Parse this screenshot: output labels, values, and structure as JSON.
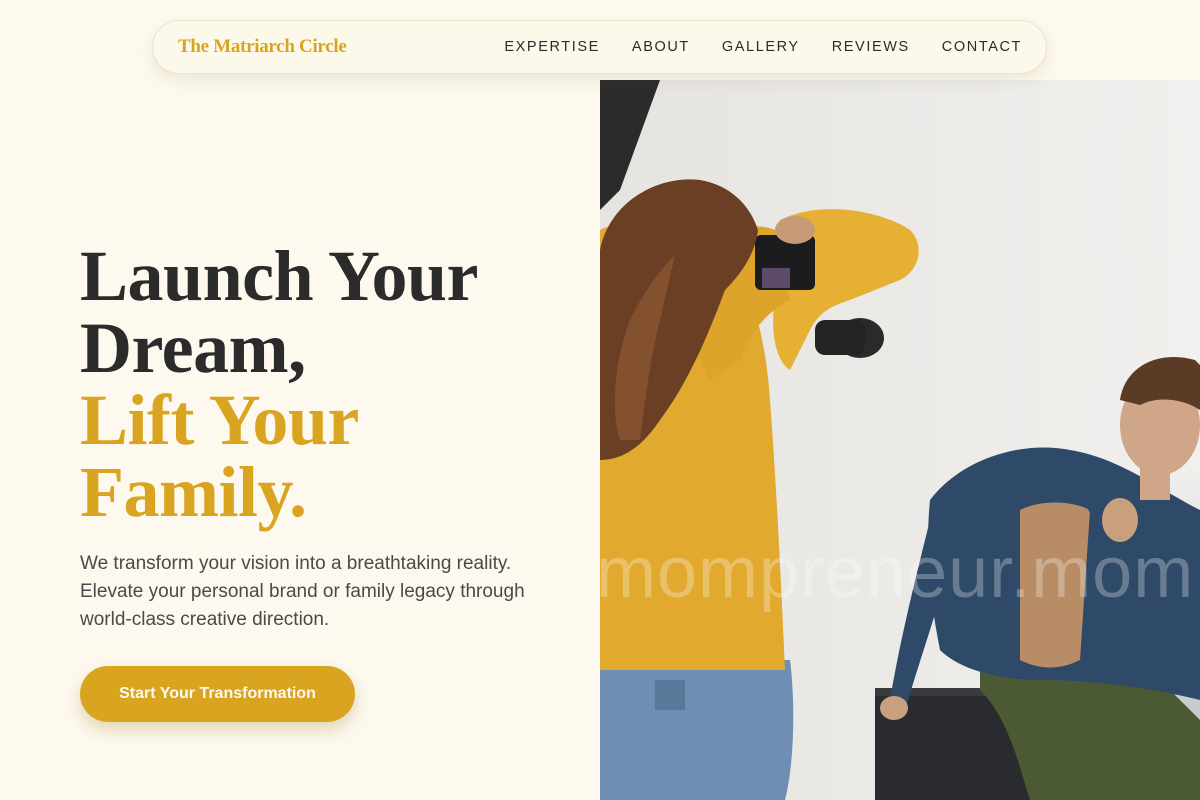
{
  "nav": {
    "brand": "The Matriarch Circle",
    "links": [
      "EXPERTISE",
      "ABOUT",
      "GALLERY",
      "REVIEWS",
      "CONTACT"
    ]
  },
  "hero": {
    "title_line1": "Launch Your",
    "title_line2": "Dream,",
    "title_line3": "Lift Your",
    "title_line4": "Family.",
    "subtitle": "We transform your vision into a breathtaking reality. Elevate your personal brand or family legacy through world-class creative direction.",
    "cta_label": "Start Your Transformation"
  },
  "image": {
    "watermark": "mompreneur.mom"
  },
  "colors": {
    "accent": "#d9a520",
    "background": "#fdf9ee",
    "text_dark": "#2b2b2b"
  }
}
